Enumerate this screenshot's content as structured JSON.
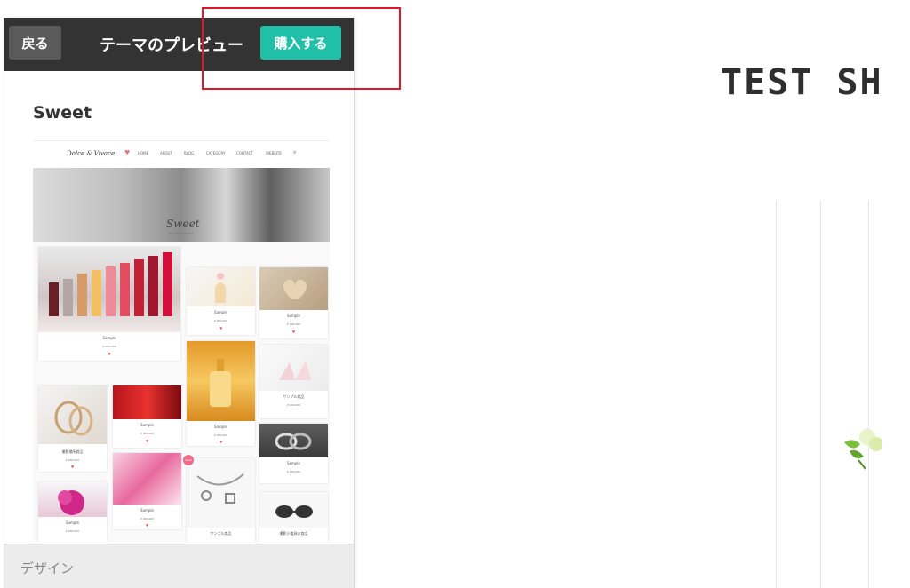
{
  "panel": {
    "back_label": "戻る",
    "title": "テーマのプレビュー",
    "buy_label": "購入する",
    "theme_name": "Sweet",
    "footer_label": "デザイン"
  },
  "thumbnail": {
    "logo": "Dolce & Vivace",
    "nav_links": [
      "HOME",
      "ABOUT",
      "BLOG",
      "CATEGORY",
      "CONTACT",
      "WEBSITE"
    ],
    "hero_logo": "Sweet",
    "hero_sub": "Be Always Modest",
    "products": [
      {
        "title": "Sample",
        "price": "¥ 000,000"
      },
      {
        "title": "Sample",
        "price": "¥ 000,000"
      },
      {
        "title": "Sample",
        "price": "¥ 000,000"
      },
      {
        "title": "Sample",
        "price": "¥ 000,000"
      },
      {
        "title": "サンプル商品",
        "price": "¥ 000,000"
      },
      {
        "title": "Sample",
        "price": "¥ 000,000"
      },
      {
        "title": "撮影場所商品",
        "price": "¥ 000,000"
      },
      {
        "title": "Sample",
        "price": "¥ 000,000"
      },
      {
        "title": "Sample",
        "price": "¥ 000,000"
      },
      {
        "title": "Sample",
        "price": "¥ 000,000"
      },
      {
        "title": "Sample",
        "price": "¥ 000,000"
      },
      {
        "title": "サンプル商品",
        "price": "¥ 000,000"
      },
      {
        "title": "撮影小道具の商品",
        "price": "¥ 000,000"
      }
    ],
    "sale_badge": "SALE"
  },
  "shop": {
    "title": "TEST SHOP"
  },
  "colors": {
    "topbar": "#333333",
    "buy_button": "#20c0a8",
    "highlight": "#e0162b"
  }
}
